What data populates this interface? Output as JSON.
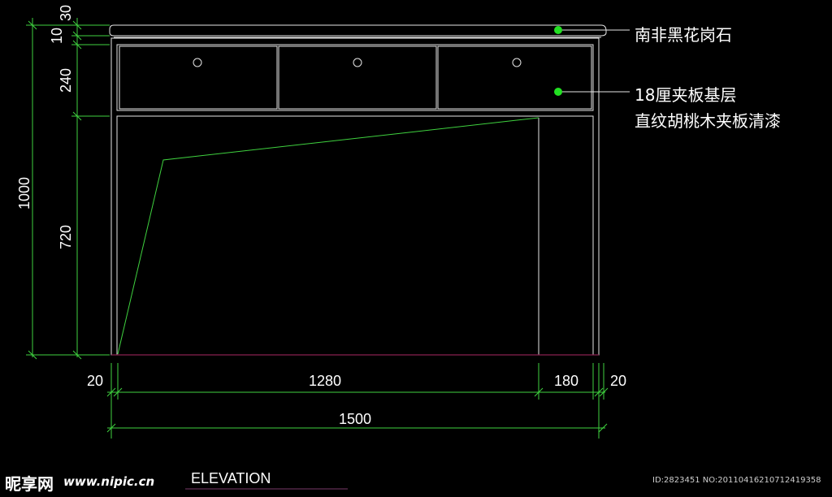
{
  "drawing": {
    "annotations": [
      {
        "text": "南非黑花岗石"
      },
      {
        "text": "18厘夹板基层"
      },
      {
        "text": "直纹胡桃木夹板清漆"
      }
    ],
    "dimensions_vertical": [
      "30",
      "10",
      "240",
      "1000",
      "720"
    ],
    "dimensions_horizontal": [
      "20",
      "1280",
      "180",
      "20",
      "1500"
    ],
    "view_label": "ELEVATION",
    "colors": {
      "line": "#e6e6e6",
      "dimension": "#3fd23f",
      "leader_dot": "#22e022",
      "floor": "#8a2050"
    }
  },
  "watermark": {
    "logo": "昵享网",
    "site": "www.nipic.cn",
    "id_text": "ID:2823451 NO:20110416210712419358"
  }
}
